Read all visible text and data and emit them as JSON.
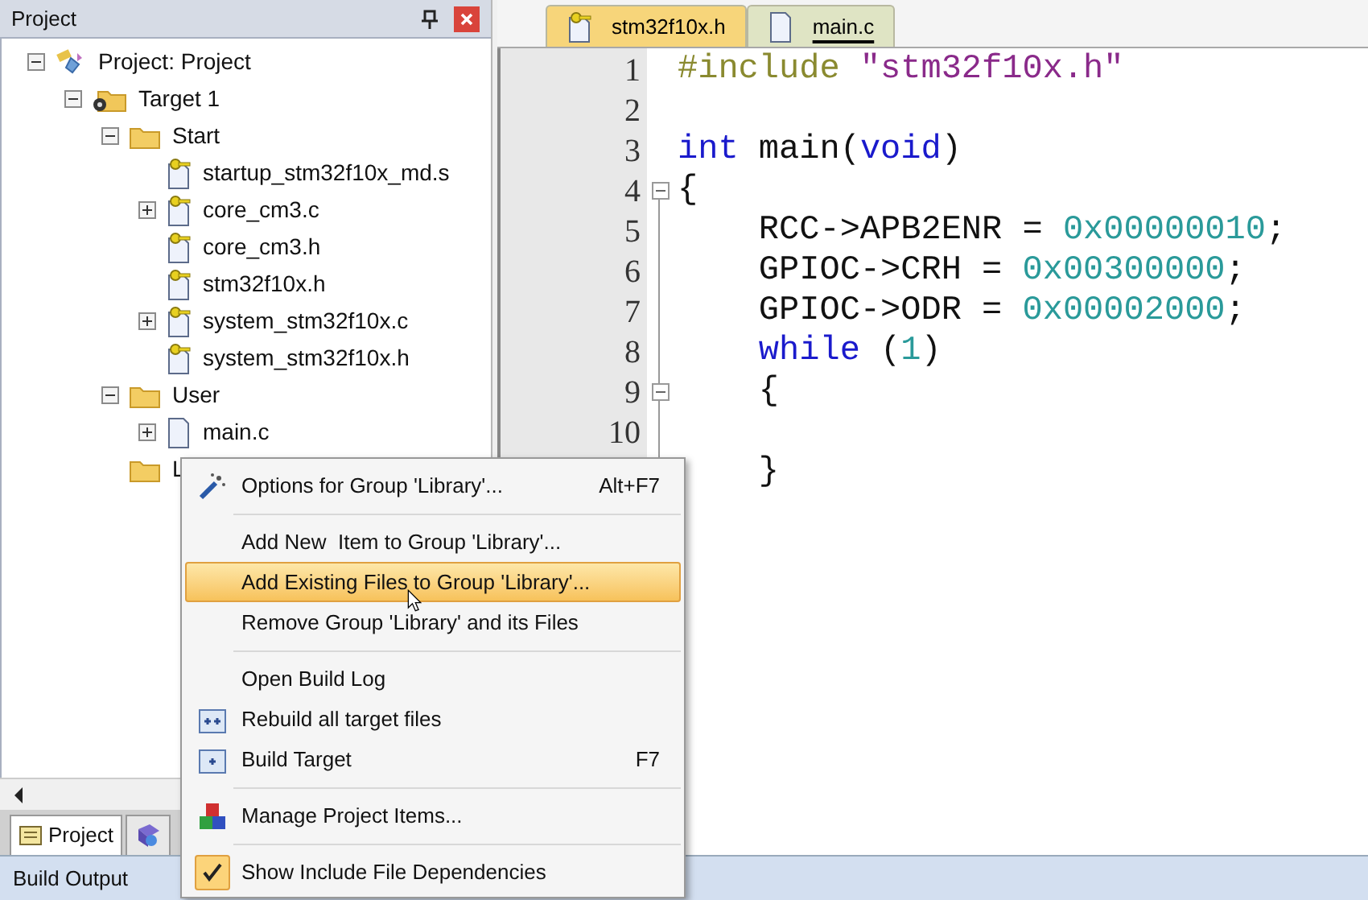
{
  "project_panel": {
    "title": "Project",
    "tree": [
      {
        "label": "Project: Project",
        "kind": "project",
        "expanded": true,
        "children": [
          {
            "label": "Target 1",
            "kind": "target",
            "expanded": true,
            "children": [
              {
                "label": "Start",
                "kind": "folder",
                "expanded": true,
                "children": [
                  {
                    "label": "startup_stm32f10x_md.s",
                    "kind": "keyfile"
                  },
                  {
                    "label": "core_cm3.c",
                    "kind": "keyfile",
                    "expanded": false
                  },
                  {
                    "label": "core_cm3.h",
                    "kind": "keyfile"
                  },
                  {
                    "label": "stm32f10x.h",
                    "kind": "keyfile"
                  },
                  {
                    "label": "system_stm32f10x.c",
                    "kind": "keyfile",
                    "expanded": false
                  },
                  {
                    "label": "system_stm32f10x.h",
                    "kind": "keyfile"
                  }
                ]
              },
              {
                "label": "User",
                "kind": "folder",
                "expanded": true,
                "children": [
                  {
                    "label": "main.c",
                    "kind": "file",
                    "expanded": false
                  }
                ]
              },
              {
                "label": "L",
                "kind": "folder"
              }
            ]
          }
        ]
      }
    ],
    "bottom_tabs": [
      {
        "label": "Project",
        "selected": true
      },
      {
        "selected": false
      }
    ]
  },
  "editor": {
    "tabs": [
      {
        "label": "stm32f10x.h",
        "kind": "keyfile",
        "selected": false
      },
      {
        "label": "main.c",
        "kind": "file",
        "selected": true
      }
    ],
    "lines": [
      {
        "number": "1",
        "tokens": [
          {
            "kind": "pre",
            "text": "#include "
          },
          {
            "kind": "str",
            "text": "\"stm32f10x.h\""
          }
        ]
      },
      {
        "number": "2"
      },
      {
        "number": "3",
        "tokens": [
          {
            "kind": "kw",
            "text": "int"
          },
          {
            "kind": "plain",
            "text": " main("
          },
          {
            "kind": "kw",
            "text": "void"
          },
          {
            "kind": "plain",
            "text": ")"
          }
        ]
      },
      {
        "number": "4",
        "fold": true,
        "tokens": [
          {
            "kind": "plain",
            "text": "{"
          }
        ]
      },
      {
        "number": "5",
        "tokens": [
          {
            "kind": "plain",
            "text": "    RCC->APB2ENR = "
          },
          {
            "kind": "num",
            "text": "0x00000010"
          },
          {
            "kind": "plain",
            "text": ";"
          }
        ]
      },
      {
        "number": "6",
        "tokens": [
          {
            "kind": "plain",
            "text": "    GPIOC->CRH = "
          },
          {
            "kind": "num",
            "text": "0x00300000"
          },
          {
            "kind": "plain",
            "text": ";"
          }
        ]
      },
      {
        "number": "7",
        "tokens": [
          {
            "kind": "plain",
            "text": "    GPIOC->ODR = "
          },
          {
            "kind": "num",
            "text": "0x00002000"
          },
          {
            "kind": "plain",
            "text": ";"
          }
        ]
      },
      {
        "number": "8",
        "tokens": [
          {
            "kind": "kw",
            "text": "    while"
          },
          {
            "kind": "plain",
            "text": " ("
          },
          {
            "kind": "num",
            "text": "1"
          },
          {
            "kind": "plain",
            "text": ")"
          }
        ]
      },
      {
        "number": "9",
        "fold": true,
        "tokens": [
          {
            "kind": "plain",
            "text": "    {"
          }
        ]
      },
      {
        "number": "10"
      },
      {
        "tokens": [
          {
            "kind": "plain",
            "text": "    }"
          }
        ]
      }
    ]
  },
  "context_menu": {
    "items": [
      {
        "kind": "options",
        "label": "Options for Group 'Library'...",
        "shortcut": "Alt+F7",
        "selected": false
      },
      {
        "kind": "separator"
      },
      {
        "kind": "plain",
        "label": "Add New  Item to Group 'Library'...",
        "selected": false
      },
      {
        "kind": "plain",
        "label": "Add Existing Files to Group 'Library'...",
        "selected": true
      },
      {
        "kind": "plain",
        "label": "Remove Group 'Library' and its Files",
        "selected": false
      },
      {
        "kind": "separator"
      },
      {
        "kind": "plain",
        "label": "Open Build Log",
        "selected": false
      },
      {
        "kind": "rebuild",
        "label": "Rebuild all target files",
        "selected": false
      },
      {
        "kind": "build",
        "label": "Build Target",
        "shortcut": "F7",
        "selected": false
      },
      {
        "kind": "separator"
      },
      {
        "kind": "manage",
        "label": "Manage Project Items...",
        "selected": false
      },
      {
        "kind": "separator"
      },
      {
        "kind": "check",
        "label": "Show Include File Dependencies",
        "checked": true,
        "selected": false
      }
    ]
  },
  "build_output": {
    "title": "Build Output"
  }
}
